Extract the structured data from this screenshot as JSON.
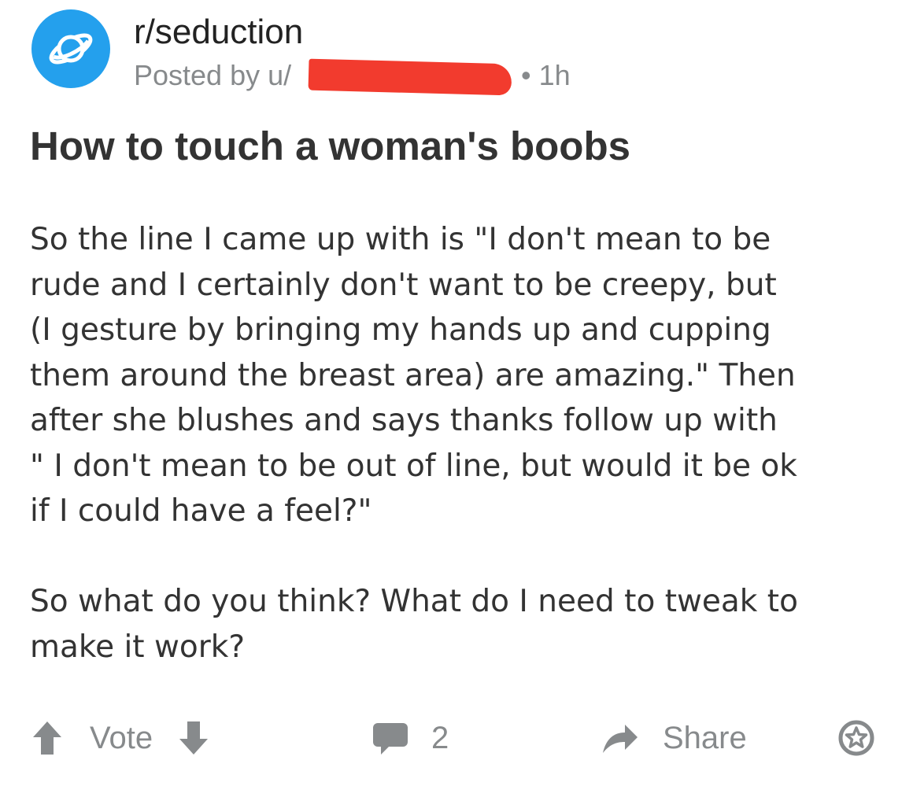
{
  "post": {
    "subreddit": "r/seduction",
    "posted_by_prefix": "Posted by u/",
    "age": "• 1h",
    "title": "How to touch a woman's boobs",
    "body_paragraph_1_lines": [
      "So the line I came up with is \"I don't mean to be",
      "rude and I certainly don't want to be creepy, but",
      "(I gesture by bringing my hands up and cupping",
      "them around the breast area) are amazing.\" Then",
      "after she blushes and says thanks follow up with",
      "\" I don't mean to be out of line, but would it be ok",
      "if I could have a feel?\""
    ],
    "body_paragraph_2_lines": [
      "So what do you think? What do I need to tweak to",
      "make it work?"
    ]
  },
  "actions": {
    "vote_label": "Vote",
    "comment_count": "2",
    "share_label": "Share"
  },
  "icons": {
    "subreddit": "planet-icon",
    "upvote": "arrow-up-icon",
    "downvote": "arrow-down-icon",
    "comments": "comment-icon",
    "share": "share-icon",
    "award": "award-icon"
  },
  "colors": {
    "avatar": "#24a0ed",
    "muted": "#878a8c",
    "redaction": "#f23b2e"
  }
}
